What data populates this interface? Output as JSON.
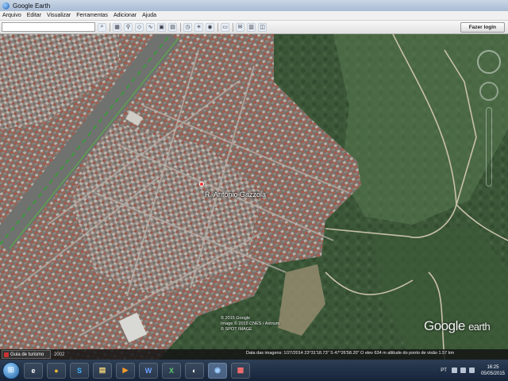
{
  "window": {
    "title": "Google Earth"
  },
  "menu": {
    "items": [
      "Arquivo",
      "Editar",
      "Visualizar",
      "Ferramentas",
      "Adicionar",
      "Ajuda"
    ]
  },
  "toolbar": {
    "login_label": "Fazer login",
    "buttons": [
      "search-icon",
      "place-icon",
      "pin-icon",
      "polygon-icon",
      "path-icon",
      "overlay-icon",
      "record-icon",
      "sky-icon",
      "ruler-icon",
      "history-icon",
      "sun-icon",
      "planet-icon",
      "email-icon",
      "print-icon",
      "maps-icon"
    ]
  },
  "map": {
    "road_label": "R. Antônio Gazzola",
    "copyright_lines": [
      "© 2015 Google",
      "Image © 2015 CNES / Astrium",
      "© SPOT IMAGE"
    ],
    "logo": {
      "google": "Google",
      "earth": "earth"
    }
  },
  "statusbar": {
    "tour_label": "Guia de turismo",
    "extra": "2002",
    "info": "Data das imagens: 1/27/2014     23°31'18.73\" S   47°26'58.20\" O   elev  634 m      altitude do ponto de visão   1.57 km"
  },
  "taskbar": {
    "apps": [
      {
        "name": "ie",
        "glyph": "e"
      },
      {
        "name": "chrome",
        "glyph": "●"
      },
      {
        "name": "skype",
        "glyph": "S"
      },
      {
        "name": "explorer",
        "glyph": "▤"
      },
      {
        "name": "media",
        "glyph": "▶"
      },
      {
        "name": "word",
        "glyph": "W"
      },
      {
        "name": "excel",
        "glyph": "X"
      },
      {
        "name": "app-gear",
        "glyph": "◐"
      },
      {
        "name": "google-earth",
        "glyph": "◉"
      },
      {
        "name": "app-flag",
        "glyph": "▦"
      }
    ],
    "lang": "PT",
    "time": "16:25",
    "date": "05/05/2015"
  },
  "colors": {
    "taskbar": "#16243a",
    "vegetation": "#3e5a3a",
    "urban": "#8a7f78"
  }
}
